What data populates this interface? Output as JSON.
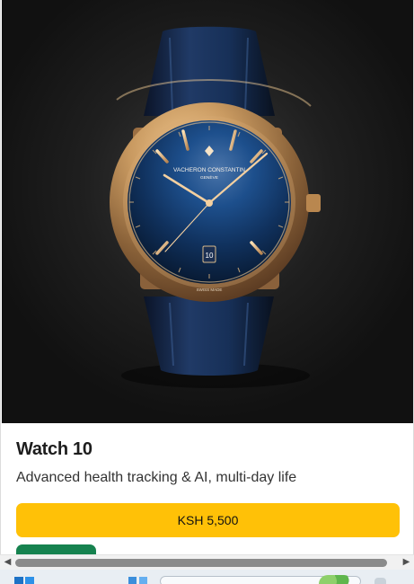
{
  "product": {
    "title": "Watch 10",
    "description": "Advanced health tracking & AI, multi-day life",
    "price_label": "KSH 5,500",
    "image": {
      "brand_text": "VACHERON CONSTANTIN",
      "city_text": "GENÈVE",
      "date_value": "10",
      "footer_text": "SWISS MADE"
    }
  },
  "colors": {
    "price_button": "#ffc107",
    "secondary_button": "#16824f",
    "watch_dial": "#123b72",
    "watch_case": "#c2935a",
    "strap": "#16274a"
  },
  "icons": {
    "scroll_left": "triangle-left-icon",
    "scroll_right": "triangle-right-icon",
    "start": "windows-start-icon"
  }
}
